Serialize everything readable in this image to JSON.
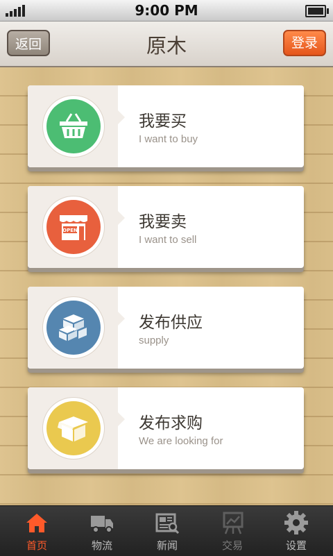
{
  "status_bar": {
    "time": "9:00 PM"
  },
  "header": {
    "back_label": "返回",
    "title": "原木",
    "login_label": "登录"
  },
  "menu": [
    {
      "title": "我要买",
      "subtitle": "I want to buy",
      "color": "#4cbd73",
      "icon": "shopping-basket-icon"
    },
    {
      "title": "我要卖",
      "subtitle": "I want to sell",
      "color": "#e8603d",
      "icon": "open-shop-icon",
      "badge": "OPEN"
    },
    {
      "title": "发布供应",
      "subtitle": "supply",
      "color": "#5586b0",
      "icon": "boxes-icon"
    },
    {
      "title": "发布求购",
      "subtitle": "We are looking for",
      "color": "#eac94f",
      "icon": "open-box-icon"
    }
  ],
  "tabs": [
    {
      "label": "首页",
      "icon": "home-icon",
      "state": "active"
    },
    {
      "label": "物流",
      "icon": "truck-icon",
      "state": "normal"
    },
    {
      "label": "新闻",
      "icon": "newspaper-icon",
      "state": "normal"
    },
    {
      "label": "交易",
      "icon": "chart-board-icon",
      "state": "dim"
    },
    {
      "label": "设置",
      "icon": "gear-icon",
      "state": "normal"
    }
  ],
  "colors": {
    "accent": "#ff5a2a",
    "login": "#e5561c",
    "wood": "#dcc089"
  }
}
